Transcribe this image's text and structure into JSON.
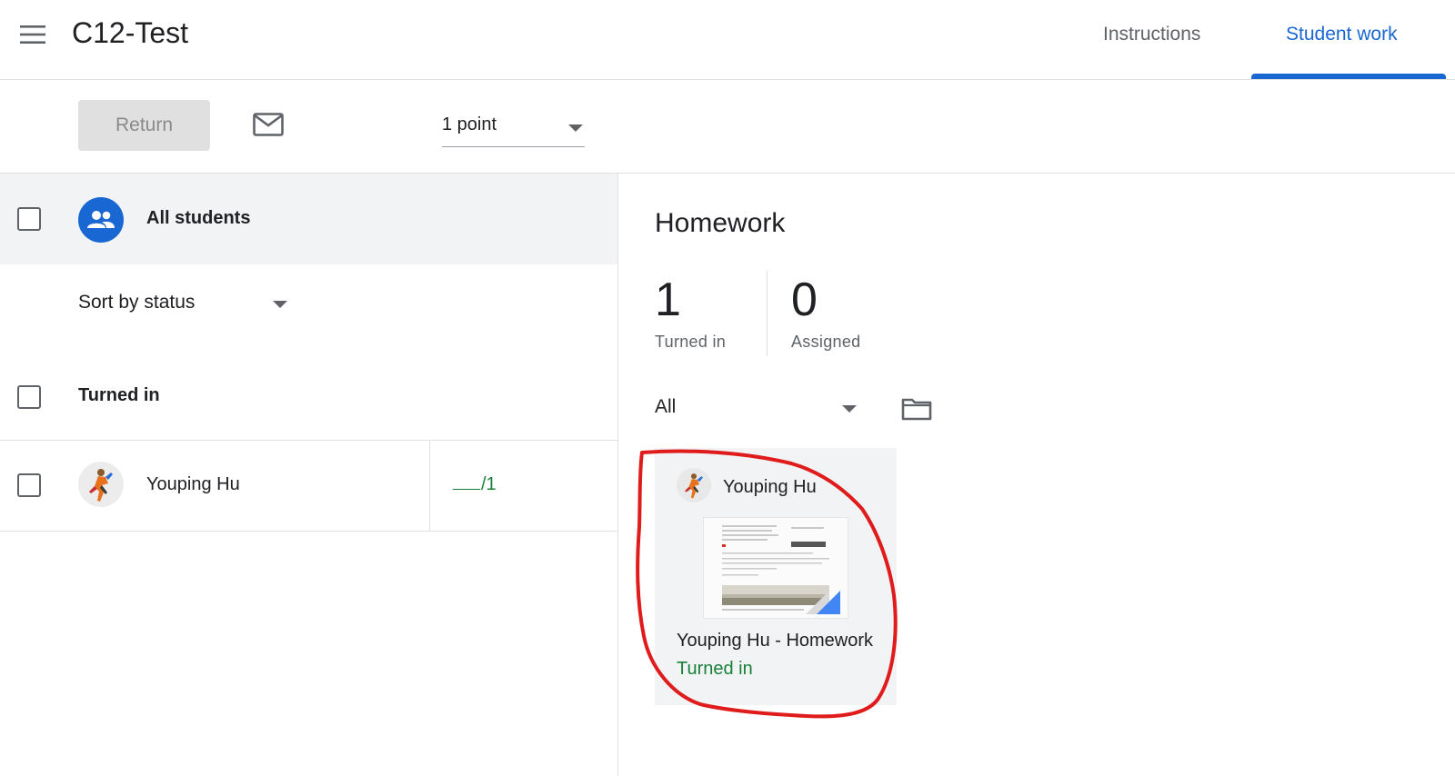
{
  "header": {
    "class_title": "C12-Test",
    "tabs": [
      {
        "label": "Instructions",
        "active": false
      },
      {
        "label": "Student work",
        "active": true
      }
    ]
  },
  "toolbar": {
    "return_label": "Return",
    "points_value": "1 point"
  },
  "left_panel": {
    "all_students_label": "All students",
    "sort_label": "Sort by status",
    "section_label": "Turned in",
    "students": [
      {
        "name": "Youping Hu",
        "grade_denominator": "/1"
      }
    ]
  },
  "right_panel": {
    "assignment_title": "Homework",
    "stats": [
      {
        "value": "1",
        "label": "Turned in"
      },
      {
        "value": "0",
        "label": "Assigned"
      }
    ],
    "filter_value": "All",
    "cards": [
      {
        "student_name": "Youping Hu",
        "file_title": "Youping Hu - Homework",
        "status": "Turned in"
      }
    ]
  },
  "colors": {
    "accent_blue": "#1967d2",
    "status_green": "#188038",
    "annotation_red": "#e01b1b",
    "panel_grey": "#f1f3f4"
  },
  "icons": [
    "menu-icon",
    "mail-icon",
    "dropdown-arrow-icon",
    "group-icon",
    "folder-icon",
    "docs-icon"
  ]
}
